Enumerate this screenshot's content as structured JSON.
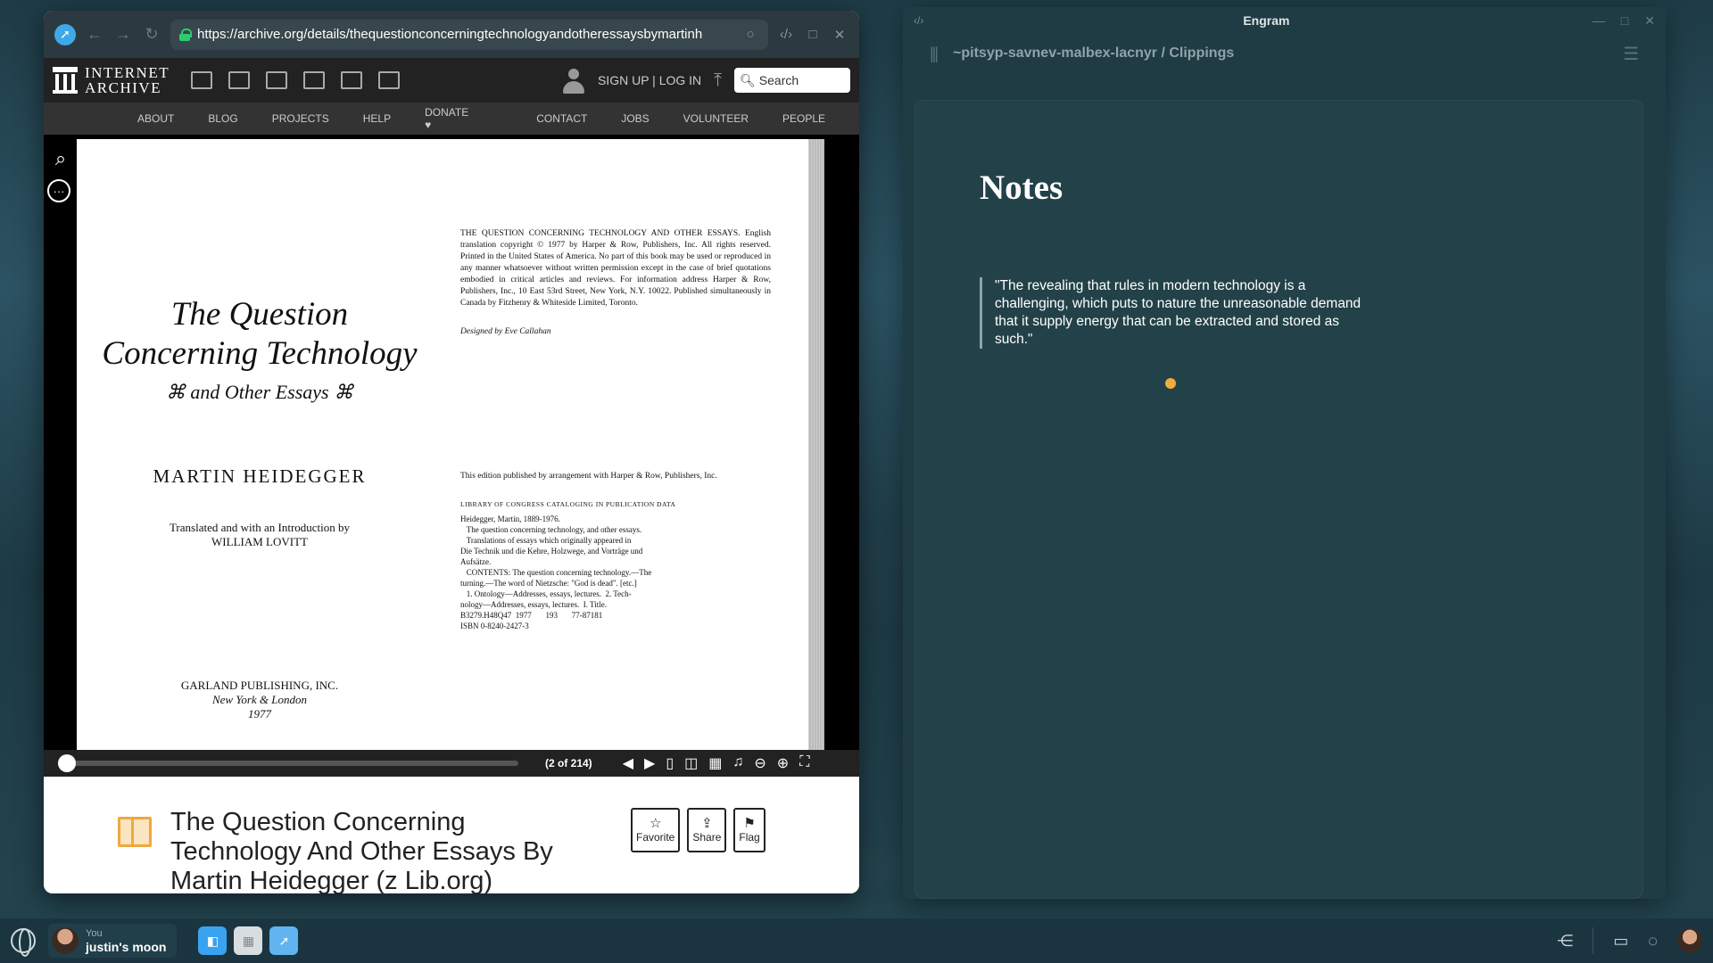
{
  "browser": {
    "url": "https://archive.org/details/thequestionconcerningtechnologyandotheressaysbymartinh"
  },
  "ia": {
    "logo_line1": "INTERNET",
    "logo_line2": "ARCHIVE",
    "signup": "SIGN UP | LOG IN",
    "search_placeholder": "Search",
    "nav": [
      "ABOUT",
      "BLOG",
      "PROJECTS",
      "HELP",
      "DONATE",
      "CONTACT",
      "JOBS",
      "VOLUNTEER",
      "PEOPLE"
    ]
  },
  "page": {
    "title_line1": "The Question",
    "title_line2": "Concerning Technology",
    "subtitle": "and Other Essays",
    "author": "MARTIN HEIDEGGER",
    "translated_line1": "Translated and with an Introduction by",
    "translated_line2": "WILLIAM LOVITT",
    "publisher": "GARLAND PUBLISHING, INC.",
    "pub_place": "New York & London",
    "pub_year": "1977",
    "copyright": "THE QUESTION CONCERNING TECHNOLOGY AND OTHER ESSAYS. English translation copyright © 1977 by Harper & Row, Publishers, Inc. All rights reserved. Printed in the United States of America. No part of this book may be used or reproduced in any manner whatsoever without written permission except in the case of brief quotations embodied in critical articles and reviews. For information address Harper & Row, Publishers, Inc., 10 East 53rd Street, New York, N.Y. 10022. Published simultaneously in Canada by Fitzhenry & Whiteside Limited, Toronto.",
    "designed_by": "Designed by Eve Callahan",
    "edition": "This edition published by arrangement with Harper & Row, Publishers, Inc.",
    "loc_heading": "LIBRARY OF CONGRESS CATALOGING IN PUBLICATION DATA",
    "loc_lines": [
      "Heidegger, Martin, 1889-1976.",
      "   The question concerning technology, and other essays.",
      "",
      "   Translations of essays which originally appeared in",
      "Die Technik und die Kehre, Holzwege, and Vorträge und",
      "Aufsätze.",
      "   CONTENTS: The question concerning technology.—The",
      "turning.—The word of Nietzsche: \"God is dead\". [etc.]",
      "   1. Ontology—Addresses, essays, lectures.  2. Tech-",
      "nology—Addresses, essays, lectures.  I. Title.",
      "B3279.H48Q47  1977       193       77-87181",
      "ISBN 0-8240-2427-3"
    ]
  },
  "reader": {
    "page_count": "(2 of 214)",
    "progress_fraction": 0.0
  },
  "item": {
    "title": "The Question Concerning Technology And Other Essays By Martin Heidegger (z Lib.org)",
    "favorite": "Favorite",
    "share": "Share",
    "flag": "Flag"
  },
  "engram": {
    "window_title": "Engram",
    "breadcrumb": "~pitsyp-savnev-malbex-lacnyr / Clippings",
    "heading": "Notes",
    "quote": "\"The revealing that rules in modern technology is a challenging, which puts to nature the unreasonable demand that it supply energy that can be extracted and stored as such.\""
  },
  "taskbar": {
    "user_label": "You",
    "user_name": "justin's moon"
  },
  "colors": {
    "engram_bg": "#1f3b43",
    "accent_dot": "#f0ad3d",
    "browser_toolbar": "#2b3a40"
  }
}
